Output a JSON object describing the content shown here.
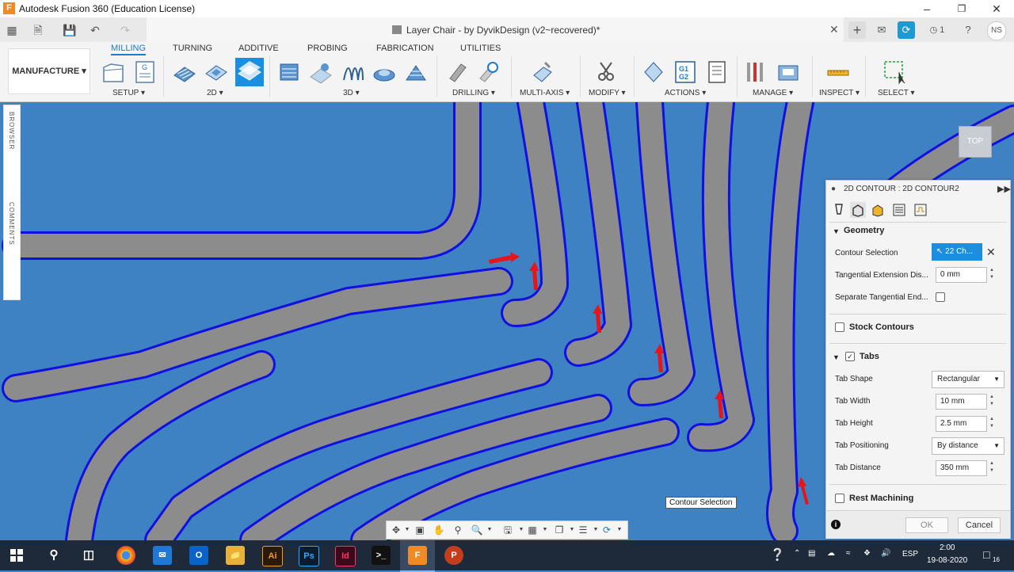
{
  "window": {
    "title": "Autodesk Fusion 360 (Education License)",
    "document_title": "Layer Chair - by DyvikDesign (v2~recovered)*",
    "user_initials": "NS",
    "job_count": "1"
  },
  "toolbar": {
    "workspace": "MANUFACTURE",
    "tabs": [
      "MILLING",
      "TURNING",
      "ADDITIVE",
      "PROBING",
      "FABRICATION",
      "UTILITIES"
    ],
    "groups": [
      "SETUP",
      "2D",
      "3D",
      "DRILLING",
      "MULTI-AXIS",
      "MODIFY",
      "ACTIONS",
      "MANAGE",
      "INSPECT",
      "SELECT"
    ]
  },
  "sidebar": {
    "browser_label": "BROWSER",
    "comments_label": "COMMENTS"
  },
  "viewcube": {
    "label": "TOP"
  },
  "panel": {
    "title": "2D CONTOUR : 2D CONTOUR2",
    "geometry": {
      "heading": "Geometry",
      "contour_selection_label": "Contour Selection",
      "contour_selection_value": "22 Ch...",
      "tangential_extension_label": "Tangential Extension Dis...",
      "tangential_extension_value": "0 mm",
      "separate_tangential_label": "Separate Tangential End..."
    },
    "stock_contours_label": "Stock Contours",
    "tabs": {
      "heading": "Tabs",
      "tab_shape_label": "Tab Shape",
      "tab_shape_value": "Rectangular",
      "tab_width_label": "Tab Width",
      "tab_width_value": "10 mm",
      "tab_height_label": "Tab Height",
      "tab_height_value": "2.5 mm",
      "tab_positioning_label": "Tab Positioning",
      "tab_positioning_value": "By distance",
      "tab_distance_label": "Tab Distance",
      "tab_distance_value": "350 mm"
    },
    "rest_machining_label": "Rest Machining",
    "ok_label": "OK",
    "cancel_label": "Cancel"
  },
  "tooltip": "Contour Selection",
  "taskbar": {
    "language": "ESP",
    "time": "2:00",
    "date": "19-08-2020",
    "notification_count": "16"
  },
  "colors": {
    "canvas_bg": "#3f82c4",
    "part_fill": "#8c8c8c",
    "toolpath": "#1010e0",
    "accent": "#1b7ad4",
    "arrow": "#e8141a"
  }
}
